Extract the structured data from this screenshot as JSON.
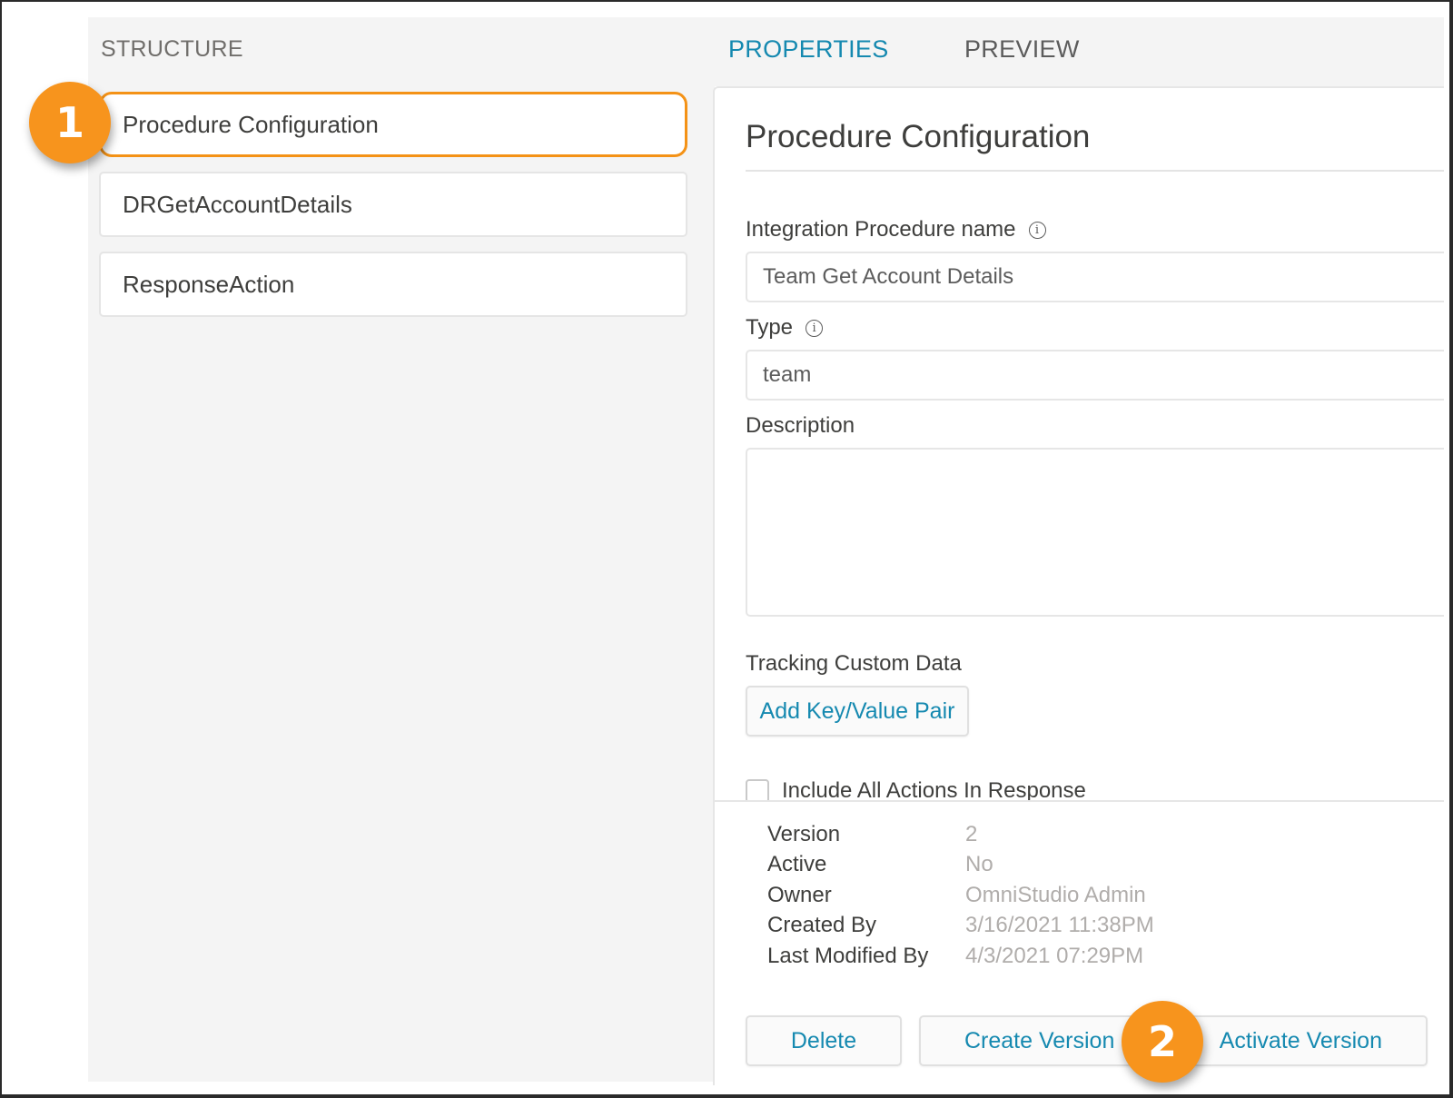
{
  "structure": {
    "title": "STRUCTURE",
    "items": [
      {
        "label": "Procedure Configuration",
        "active": true
      },
      {
        "label": "DRGetAccountDetails",
        "active": false
      },
      {
        "label": "ResponseAction",
        "active": false
      }
    ]
  },
  "tabs": [
    {
      "label": "PROPERTIES",
      "active": true
    },
    {
      "label": "PREVIEW",
      "active": false
    }
  ],
  "properties": {
    "title": "Procedure Configuration",
    "name_label": "Integration Procedure name",
    "name_value": "Team Get Account Details",
    "type_label": "Type",
    "type_value": "team",
    "description_label": "Description",
    "description_value": "",
    "tracking_label": "Tracking Custom Data",
    "add_pair_label": "Add Key/Value Pair",
    "include_actions_label": "Include All Actions In Response",
    "include_actions_checked": false
  },
  "meta": [
    {
      "key": "Version",
      "value": "2"
    },
    {
      "key": "Active",
      "value": "No"
    },
    {
      "key": "Owner",
      "value": "OmniStudio Admin"
    },
    {
      "key": "Created By",
      "value": "3/16/2021 11:38PM"
    },
    {
      "key": "Last Modified By",
      "value": "4/3/2021 07:29PM"
    }
  ],
  "actions": {
    "delete": "Delete",
    "create_version": "Create Version",
    "activate_version": "Activate Version"
  },
  "badges": {
    "one": "1",
    "two": "2",
    "color": "#f7941d"
  },
  "colors": {
    "accent": "#1589b0",
    "highlight_border": "#f49216"
  }
}
